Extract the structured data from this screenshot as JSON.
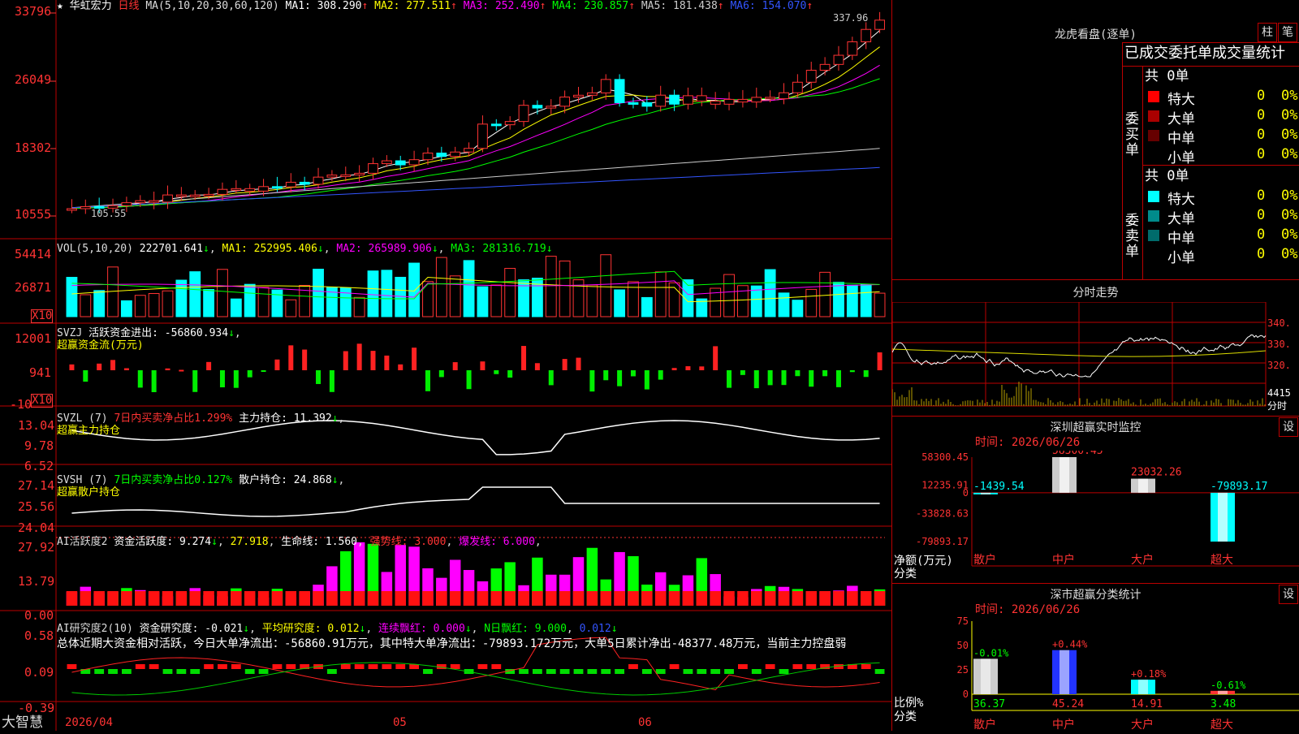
{
  "header": {
    "stock_name": "华虹宏力",
    "period": "日线",
    "ma_label": "MA(5,10,20,30,60,120)",
    "ma": [
      {
        "label": "MA1: 308.290",
        "color": "#ffffff"
      },
      {
        "label": "MA2: 277.511",
        "color": "#ffff00"
      },
      {
        "label": "MA3: 252.490",
        "color": "#ff00ff"
      },
      {
        "label": "MA4: 230.857",
        "color": "#00ff00"
      },
      {
        "label": "MA5: 181.438",
        "color": "#cccccc"
      },
      {
        "label": "MA6: 154.070",
        "color": "#3355ff"
      }
    ],
    "high_label": "337.96",
    "low_label": "105.55"
  },
  "price_axis": [
    "33796",
    "26049",
    "18302",
    "10555"
  ],
  "vol": {
    "label": "VOL(5,10,20)",
    "value": "222701.641",
    "ma1": "MA1: 252995.406",
    "ma2": "MA2: 265989.906",
    "ma3": "MA3: 281316.719",
    "axis": [
      "54414",
      "26871"
    ],
    "unit": "X10"
  },
  "svzj": {
    "label": "SVZJ",
    "title": "活跃资金进出: -56860.934",
    "subtitle": "超赢资金流(万元)",
    "axis": [
      "12001",
      "941",
      "-10"
    ],
    "unit": "X10"
  },
  "svzl": {
    "label": "SVZL (7)",
    "ratio": "7日内买卖净占比1.299%",
    "hold": "主力持仓: 11.392",
    "subtitle": "超赢主力持仓",
    "axis": [
      "13.04",
      "9.78",
      "6.52"
    ]
  },
  "svsh": {
    "label": "SVSH (7)",
    "ratio": "7日内买卖净占比0.127%",
    "hold": "散户持仓: 24.868",
    "subtitle": "超赢散户持仓",
    "axis": [
      "27.14",
      "25.56",
      "24.04"
    ]
  },
  "ai_active": {
    "label": "AI活跃度2",
    "a": "资金活跃度: 9.274",
    "b": "27.918",
    "c": "生命线: 1.560",
    "d": "强势线: 3.000",
    "e": "爆发线: 6.000",
    "axis": [
      "27.92",
      "13.79",
      "0.00"
    ]
  },
  "ai_research": {
    "label": "AI研究度2(10)",
    "a": "资金研究度: -0.021",
    "b": "平均研究度: 0.012",
    "c": "连续飘红: 0.000",
    "d": "N日飘红: 9.000",
    "e": "0.012",
    "summary": "总体近期大资金相对活跃，今日大单净流出：-56860.91万元，其中特大单净流出：-79893.172万元，大单5日累计净出-48377.48万元，当前主力控盘弱",
    "axis": [
      "0.58",
      "0.09",
      "-0.39"
    ]
  },
  "footer": {
    "brand": "大智慧",
    "date": "2026/04",
    "months": [
      "05",
      "06"
    ]
  },
  "dragon": {
    "title": "龙虎看盘(逐单)",
    "btn_bar": "柱",
    "btn_pen": "笔",
    "subtitle": "已成交委托单成交量统计",
    "buy_label": "委买单",
    "sell_label": "委卖单",
    "buy_total": "共 0单",
    "sell_total": "共 0单",
    "buy_rows": [
      {
        "name": "特大",
        "val": "0",
        "pct": "0%",
        "color": "#ff0000"
      },
      {
        "name": "大单",
        "val": "0",
        "pct": "0%",
        "color": "#aa0000"
      },
      {
        "name": "中单",
        "val": "0",
        "pct": "0%",
        "color": "#660000"
      },
      {
        "name": "小单",
        "val": "0",
        "pct": "0%",
        "color": "#000000"
      }
    ],
    "sell_rows": [
      {
        "name": "特大",
        "val": "0",
        "pct": "0%",
        "color": "#00ffff"
      },
      {
        "name": "大单",
        "val": "0",
        "pct": "0%",
        "color": "#008b8b"
      },
      {
        "name": "中单",
        "val": "0",
        "pct": "0%",
        "color": "#006b6b"
      },
      {
        "name": "小单",
        "val": "0",
        "pct": "0%",
        "color": "#000000"
      }
    ]
  },
  "intraday": {
    "title": "分时走势",
    "axis": [
      "340.",
      "330.",
      "320."
    ],
    "vol": "4415",
    "unit": "分时"
  },
  "sz_monitor": {
    "title": "深圳超赢实时监控",
    "btn": "设",
    "time": "时间: 2026/06/26",
    "ylabel": "净额(万元)",
    "xlabel": "分类",
    "axis": [
      "58300.45",
      "12235.91",
      "0",
      "-33828.63",
      "-79893.17"
    ],
    "categories": [
      "散户",
      "中户",
      "大户",
      "超大"
    ],
    "values": [
      -1439.54,
      58300.45,
      23032.26,
      -79893.17
    ],
    "value_labels": [
      "-1439.54",
      "58300.45",
      "23032.26",
      "-79893.17"
    ]
  },
  "sz_stats": {
    "title": "深市超赢分类统计",
    "btn": "设",
    "time": "时间: 2026/06/26",
    "ylabel": "比例%",
    "xlabel": "分类",
    "axis": [
      "75",
      "50",
      "25",
      "0"
    ],
    "categories": [
      "散户",
      "中户",
      "大户",
      "超大"
    ],
    "values": [
      36.37,
      45.24,
      14.91,
      3.48
    ],
    "value_labels": [
      "36.37",
      "45.24",
      "14.91",
      "3.48"
    ],
    "changes": [
      "-0.01%",
      "+0.44%",
      "+0.18%",
      "-0.61%"
    ]
  },
  "chart_data": {
    "type": "bar",
    "title": "深圳超赢实时监控",
    "categories": [
      "散户",
      "中户",
      "大户",
      "超大"
    ],
    "series": [
      {
        "name": "净额(万元)",
        "values": [
          -1439.54,
          58300.45,
          23032.26,
          -79893.17
        ]
      },
      {
        "name": "比例%",
        "values": [
          36.37,
          45.24,
          14.91,
          3.48
        ]
      }
    ]
  }
}
